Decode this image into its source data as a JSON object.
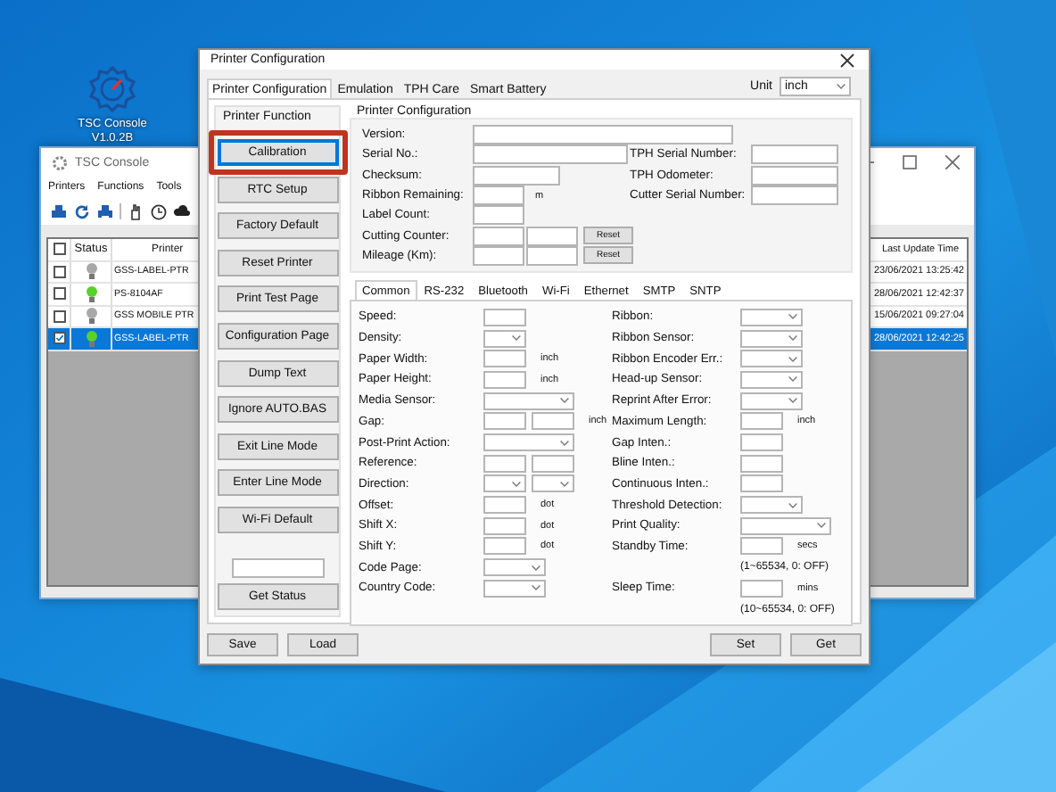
{
  "desktop_icon": {
    "label": "TSC Console V1.0.2B"
  },
  "console_window": {
    "title": "TSC Console",
    "menu": [
      "Printers",
      "Functions",
      "Tools"
    ],
    "table": {
      "header_checked": false,
      "columns": [
        "Status",
        "Printer",
        "Last Update Time"
      ],
      "rows": [
        {
          "checked": false,
          "online": false,
          "printer": "GSS-LABEL-PTR",
          "time": "23/06/2021 13:25:42",
          "selected": false
        },
        {
          "checked": false,
          "online": true,
          "printer": "PS-8104AF",
          "time": "28/06/2021 12:42:37",
          "selected": false
        },
        {
          "checked": false,
          "online": false,
          "printer": "GSS MOBILE PTR",
          "time": "15/06/2021 09:27:04",
          "selected": false
        },
        {
          "checked": true,
          "online": true,
          "printer": "GSS-LABEL-PTR",
          "time": "28/06/2021 12:42:25",
          "selected": true
        }
      ]
    }
  },
  "dialog": {
    "title": "Printer Configuration",
    "tabs": [
      {
        "label": "Printer Configuration",
        "selected": true
      },
      {
        "label": "Emulation",
        "selected": false
      },
      {
        "label": "TPH Care",
        "selected": false
      },
      {
        "label": "Smart Battery",
        "selected": false
      }
    ],
    "unit": {
      "label": "Unit",
      "value": "inch"
    },
    "function_group": {
      "title": "Printer Function",
      "buttons": [
        {
          "label": "Calibration",
          "focused": true,
          "highlighted": true
        },
        {
          "label": "RTC Setup",
          "focused": false,
          "highlighted": false
        },
        {
          "label": "Factory Default",
          "focused": false,
          "highlighted": false
        },
        {
          "label": "Reset Printer",
          "focused": false,
          "highlighted": false
        },
        {
          "label": "Print Test Page",
          "focused": false,
          "highlighted": false
        },
        {
          "label": "Configuration Page",
          "focused": false,
          "highlighted": false
        },
        {
          "label": "Dump Text",
          "focused": false,
          "highlighted": false
        },
        {
          "label": "Ignore AUTO.BAS",
          "focused": false,
          "highlighted": false
        },
        {
          "label": "Exit Line Mode",
          "focused": false,
          "highlighted": false
        },
        {
          "label": "Enter Line Mode",
          "focused": false,
          "highlighted": false
        },
        {
          "label": "Wi-Fi Default",
          "focused": false,
          "highlighted": false
        }
      ],
      "status_button": "Get Status"
    },
    "config_group": {
      "title": "Printer Configuration",
      "info_rows": [
        {
          "label": "Version:",
          "controls": [
            {
              "kind": "widebox"
            }
          ]
        },
        {
          "label": "Serial No.:",
          "controls": [
            {
              "kind": "longinput"
            }
          ],
          "side_label": "TPH Serial Number:"
        },
        {
          "label": "Checksum:",
          "controls": [
            {
              "kind": "input"
            }
          ],
          "side_label": "TPH Odometer:"
        },
        {
          "label": "Ribbon Remaining:",
          "controls": [
            {
              "kind": "shortinput"
            }
          ],
          "unit": "m",
          "side_label": "Cutter Serial Number:"
        },
        {
          "label": "Label Count:",
          "controls": [
            {
              "kind": "shortinput"
            }
          ]
        },
        {
          "label": "Cutting Counter:",
          "controls": [
            {
              "kind": "shortinput"
            },
            {
              "kind": "shortinput"
            },
            {
              "kind": "button",
              "label": "Reset"
            }
          ]
        },
        {
          "label": "Mileage (Km):",
          "controls": [
            {
              "kind": "shortinput"
            },
            {
              "kind": "shortinput"
            },
            {
              "kind": "button",
              "label": "Reset"
            }
          ]
        }
      ],
      "subtabs": [
        {
          "label": "Common",
          "selected": true
        },
        {
          "label": "RS-232",
          "selected": false
        },
        {
          "label": "Bluetooth",
          "selected": false
        },
        {
          "label": "Wi-Fi",
          "selected": false
        },
        {
          "label": "Ethernet",
          "selected": false
        },
        {
          "label": "SMTP",
          "selected": false
        },
        {
          "label": "SNTP",
          "selected": false
        }
      ],
      "left_fields": [
        {
          "label": "Speed:",
          "controls": [
            {
              "kind": "shortinput"
            }
          ]
        },
        {
          "label": "Density:",
          "controls": [
            {
              "kind": "shortselect"
            }
          ]
        },
        {
          "label": "Paper Width:",
          "controls": [
            {
              "kind": "shortinput"
            }
          ],
          "unit": "inch"
        },
        {
          "label": "Paper Height:",
          "controls": [
            {
              "kind": "shortinput"
            }
          ],
          "unit": "inch"
        },
        {
          "label": "Media Sensor:",
          "controls": [
            {
              "kind": "longselect"
            }
          ]
        },
        {
          "label": "Gap:",
          "controls": [
            {
              "kind": "shortinput"
            },
            {
              "kind": "shortinput"
            }
          ],
          "unit": "inch"
        },
        {
          "label": "Post-Print Action:",
          "controls": [
            {
              "kind": "longselect"
            }
          ]
        },
        {
          "label": "Reference:",
          "controls": [
            {
              "kind": "shortinput"
            },
            {
              "kind": "shortinput"
            }
          ]
        },
        {
          "label": "Direction:",
          "controls": [
            {
              "kind": "shortselect"
            },
            {
              "kind": "shortselect"
            }
          ]
        },
        {
          "label": "Offset:",
          "controls": [
            {
              "kind": "shortinput"
            }
          ],
          "unit": "dot"
        },
        {
          "label": "Shift X:",
          "controls": [
            {
              "kind": "shortinput"
            }
          ],
          "unit": "dot"
        },
        {
          "label": "Shift Y:",
          "controls": [
            {
              "kind": "shortinput"
            }
          ],
          "unit": "dot"
        },
        {
          "label": "Code Page:",
          "controls": [
            {
              "kind": "select"
            }
          ]
        },
        {
          "label": "Country Code:",
          "controls": [
            {
              "kind": "select"
            }
          ]
        }
      ],
      "right_fields": [
        {
          "label": "Ribbon:",
          "controls": [
            {
              "kind": "select"
            }
          ]
        },
        {
          "label": "Ribbon Sensor:",
          "controls": [
            {
              "kind": "select"
            }
          ]
        },
        {
          "label": "Ribbon Encoder Err.:",
          "controls": [
            {
              "kind": "select"
            }
          ]
        },
        {
          "label": "Head-up Sensor:",
          "controls": [
            {
              "kind": "select"
            }
          ]
        },
        {
          "label": "Reprint After Error:",
          "controls": [
            {
              "kind": "select"
            }
          ]
        },
        {
          "label": "Maximum Length:",
          "controls": [
            {
              "kind": "shortinput"
            }
          ],
          "unit": "inch"
        },
        {
          "label": "Gap Inten.:",
          "controls": [
            {
              "kind": "shortinput"
            }
          ]
        },
        {
          "label": "Bline Inten.:",
          "controls": [
            {
              "kind": "shortinput"
            }
          ]
        },
        {
          "label": "Continuous Inten.:",
          "controls": [
            {
              "kind": "shortinput"
            }
          ]
        },
        {
          "label": "Threshold Detection:",
          "controls": [
            {
              "kind": "select"
            }
          ]
        },
        {
          "label": "Print Quality:",
          "controls": [
            {
              "kind": "longselect"
            }
          ]
        },
        {
          "label": "Standby Time:",
          "controls": [
            {
              "kind": "shortinput"
            }
          ],
          "unit": "secs",
          "note": "(1~65534, 0: OFF)"
        },
        {
          "label": "Sleep Time:",
          "controls": [
            {
              "kind": "shortinput"
            }
          ],
          "unit": "mins",
          "note": "(10~65534, 0: OFF)"
        }
      ]
    },
    "footer": {
      "left_buttons": [
        "Save",
        "Load"
      ],
      "right_buttons": [
        "Set",
        "Get"
      ]
    }
  }
}
